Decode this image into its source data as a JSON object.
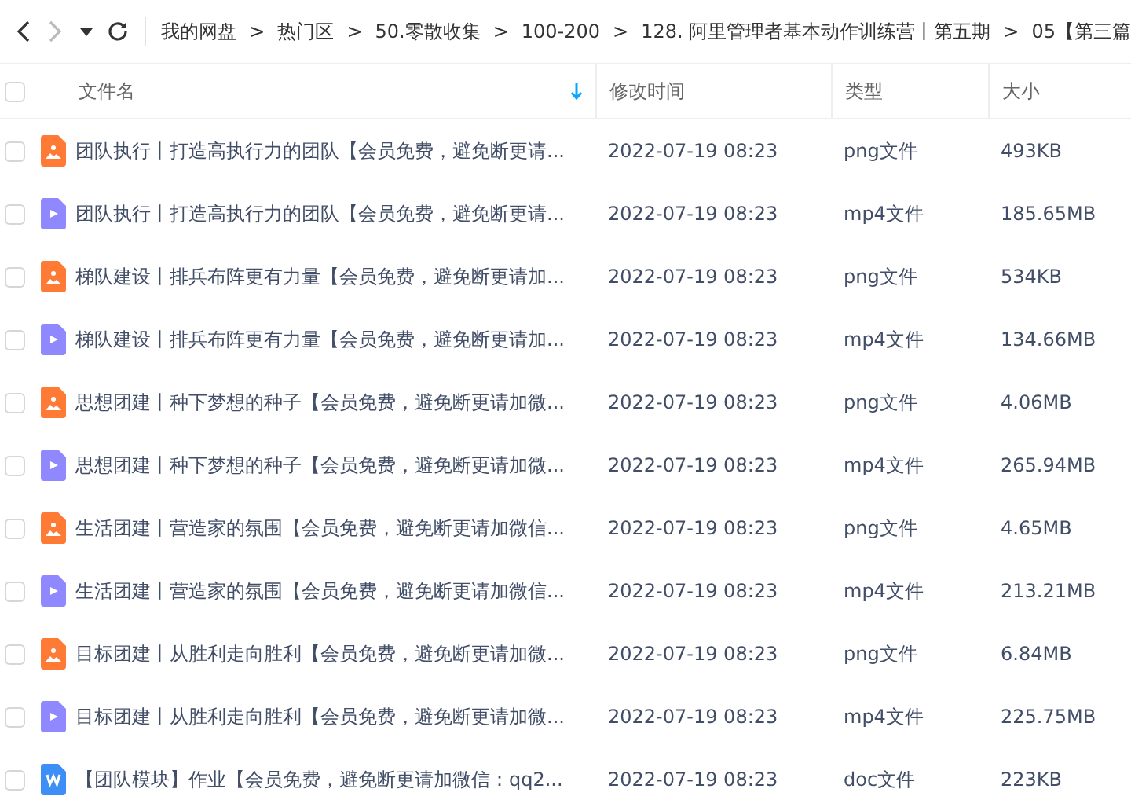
{
  "breadcrumb": [
    "我的网盘",
    "热门区",
    "50.零散收集",
    "100-200",
    "128. 阿里管理者基本动作训练营丨第五期",
    "05【第三篇"
  ],
  "breadcrumb_separator": ">",
  "table": {
    "select_all": {
      "checked": false
    },
    "columns": [
      {
        "label": "文件名",
        "sorted": true
      },
      {
        "label": "修改时间",
        "sorted": false
      },
      {
        "label": "类型",
        "sorted": false
      },
      {
        "label": "大小",
        "sorted": false
      }
    ],
    "rows": [
      {
        "kind": "image",
        "checked": false,
        "name": "团队执行丨打造高执行力的团队【会员免费，避免断更请...",
        "modified": "2022-07-19 08:23",
        "type": "png文件",
        "size": "493KB"
      },
      {
        "kind": "video",
        "checked": false,
        "name": "团队执行丨打造高执行力的团队【会员免费，避免断更请...",
        "modified": "2022-07-19 08:23",
        "type": "mp4文件",
        "size": "185.65MB"
      },
      {
        "kind": "image",
        "checked": false,
        "name": "梯队建设丨排兵布阵更有力量【会员免费，避免断更请加...",
        "modified": "2022-07-19 08:23",
        "type": "png文件",
        "size": "534KB"
      },
      {
        "kind": "video",
        "checked": false,
        "name": "梯队建设丨排兵布阵更有力量【会员免费，避免断更请加...",
        "modified": "2022-07-19 08:23",
        "type": "mp4文件",
        "size": "134.66MB"
      },
      {
        "kind": "image",
        "checked": false,
        "name": "思想团建丨种下梦想的种子【会员免费，避免断更请加微...",
        "modified": "2022-07-19 08:23",
        "type": "png文件",
        "size": "4.06MB"
      },
      {
        "kind": "video",
        "checked": false,
        "name": "思想团建丨种下梦想的种子【会员免费，避免断更请加微...",
        "modified": "2022-07-19 08:23",
        "type": "mp4文件",
        "size": "265.94MB"
      },
      {
        "kind": "image",
        "checked": false,
        "name": "生活团建丨营造家的氛围【会员免费，避免断更请加微信...",
        "modified": "2022-07-19 08:23",
        "type": "png文件",
        "size": "4.65MB"
      },
      {
        "kind": "video",
        "checked": false,
        "name": "生活团建丨营造家的氛围【会员免费，避免断更请加微信...",
        "modified": "2022-07-19 08:23",
        "type": "mp4文件",
        "size": "213.21MB"
      },
      {
        "kind": "image",
        "checked": false,
        "name": "目标团建丨从胜利走向胜利【会员免费，避免断更请加微...",
        "modified": "2022-07-19 08:23",
        "type": "png文件",
        "size": "6.84MB"
      },
      {
        "kind": "video",
        "checked": false,
        "name": "目标团建丨从胜利走向胜利【会员免费，避免断更请加微...",
        "modified": "2022-07-19 08:23",
        "type": "mp4文件",
        "size": "225.75MB"
      },
      {
        "kind": "document",
        "checked": false,
        "name": "【团队模块】作业【会员免费，避免断更请加微信：qq2...",
        "modified": "2022-07-19 08:23",
        "type": "doc文件",
        "size": "223KB"
      }
    ]
  }
}
